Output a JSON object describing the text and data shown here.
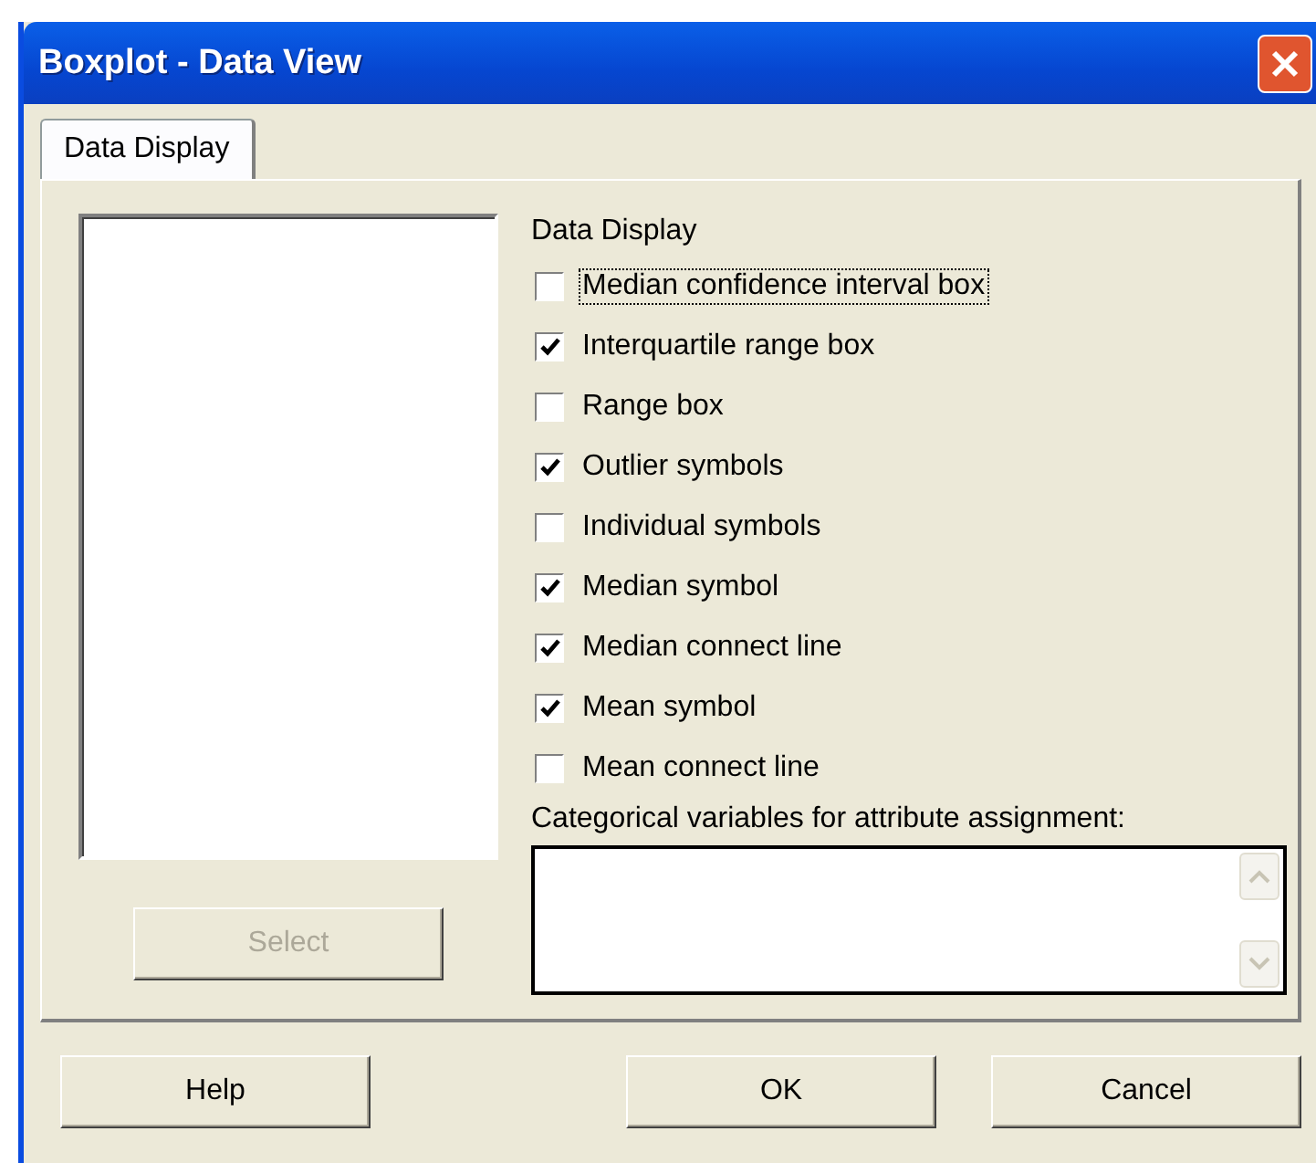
{
  "window": {
    "title": "Boxplot - Data View"
  },
  "tabs": [
    {
      "label": "Data Display",
      "selected": true
    }
  ],
  "left_panel": {
    "button": {
      "label": "Select",
      "disabled": true
    }
  },
  "data_display": {
    "heading": "Data Display",
    "options": [
      {
        "label": "Median confidence interval box",
        "checked": false,
        "focused": true
      },
      {
        "label": "Interquartile range box",
        "checked": true,
        "focused": false
      },
      {
        "label": "Range box",
        "checked": false,
        "focused": false
      },
      {
        "label": "Outlier symbols",
        "checked": true,
        "focused": false
      },
      {
        "label": "Individual symbols",
        "checked": false,
        "focused": false
      },
      {
        "label": "Median symbol",
        "checked": true,
        "focused": false
      },
      {
        "label": "Median connect line",
        "checked": true,
        "focused": false
      },
      {
        "label": "Mean symbol",
        "checked": true,
        "focused": false
      },
      {
        "label": "Mean connect line",
        "checked": false,
        "focused": false
      }
    ],
    "categorical_label": "Categorical variables for attribute assignment:"
  },
  "buttons": [
    {
      "label": "Help",
      "kind": "left"
    },
    {
      "label": "OK",
      "kind": "right"
    },
    {
      "label": "Cancel",
      "kind": "right"
    }
  ]
}
